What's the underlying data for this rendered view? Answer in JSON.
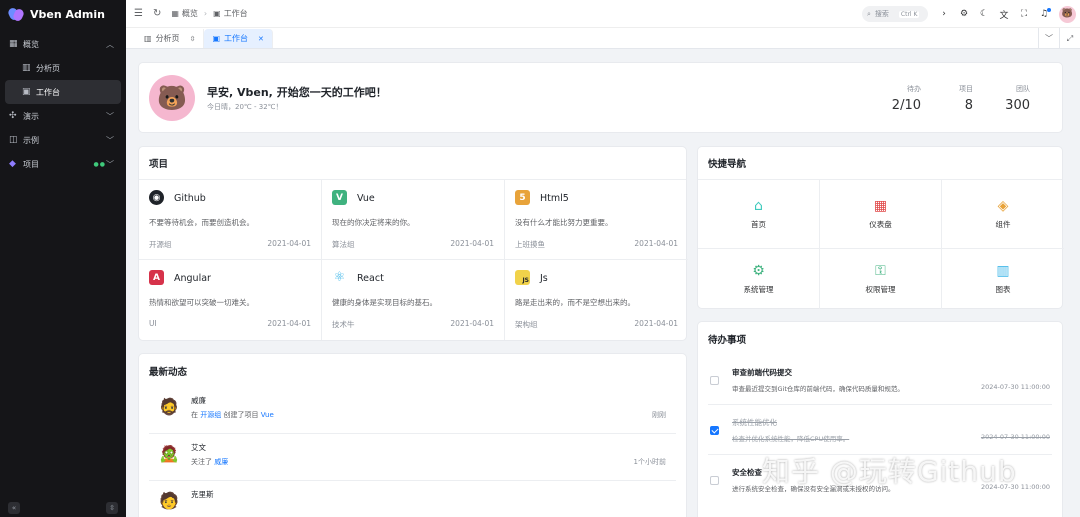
{
  "app": {
    "title": "Vben Admin"
  },
  "sidebar": {
    "items": [
      {
        "label": "概览",
        "icon": "grid-icon",
        "expanded": true
      },
      {
        "label": "分析页",
        "icon": "chart-icon"
      },
      {
        "label": "工作台",
        "icon": "workspace-icon",
        "active": true
      },
      {
        "label": "演示",
        "icon": "sparkle-icon"
      },
      {
        "label": "示例",
        "icon": "layers-icon"
      },
      {
        "label": "项目",
        "icon": "vben-logo-icon"
      }
    ],
    "collapse_label": "«",
    "pin_label": "⇳"
  },
  "header": {
    "breadcrumb": [
      "概览",
      "工作台"
    ],
    "search_placeholder": "搜索",
    "search_shortcut": "Ctrl K"
  },
  "tabs": [
    {
      "label": "分析页",
      "pinned": true
    },
    {
      "label": "工作台",
      "active": true
    }
  ],
  "welcome": {
    "greeting": "早安, Vben, 开始您一天的工作吧！",
    "weather": "今日晴，20℃ - 32℃！",
    "stats": [
      {
        "label": "待办",
        "value": "2/10"
      },
      {
        "label": "项目",
        "value": "8"
      },
      {
        "label": "团队",
        "value": "300"
      }
    ]
  },
  "projects": {
    "title": "项目",
    "items": [
      {
        "name": "Github",
        "desc": "不要等待机会，而要创造机会。",
        "group": "开源组",
        "date": "2021-04-01",
        "color": "#1f2329",
        "glyph": "◉"
      },
      {
        "name": "Vue",
        "desc": "现在的你决定将来的你。",
        "group": "算法组",
        "date": "2021-04-01",
        "color": "#3fb27f",
        "glyph": "V"
      },
      {
        "name": "Html5",
        "desc": "没有什么才能比努力更重要。",
        "group": "上班摸鱼",
        "date": "2021-04-01",
        "color": "#e8a33a",
        "glyph": "5"
      },
      {
        "name": "Angular",
        "desc": "热情和欲望可以突破一切难关。",
        "group": "UI",
        "date": "2021-04-01",
        "color": "#d6324a",
        "glyph": "A"
      },
      {
        "name": "React",
        "desc": "健康的身体是实现目标的基石。",
        "group": "技术牛",
        "date": "2021-04-01",
        "color": "#3db6e8",
        "glyph": "⚛"
      },
      {
        "name": "Js",
        "desc": "路是走出来的，而不是空想出来的。",
        "group": "架构组",
        "date": "2021-04-01",
        "color": "#f1d24a",
        "glyph": "JS"
      }
    ]
  },
  "news": {
    "title": "最新动态",
    "items": [
      {
        "name": "威廉",
        "text_pre": "在 ",
        "link1": "开源组",
        "text_mid": " 创建了项目 ",
        "link2": "Vue",
        "time": "刚刚"
      },
      {
        "name": "艾文",
        "text_pre": "关注了 ",
        "link1": "威廉",
        "text_mid": "",
        "link2": "",
        "time": "1个小时前"
      },
      {
        "name": "克里斯",
        "text_pre": "",
        "link1": "",
        "text_mid": "",
        "link2": "",
        "time": ""
      }
    ]
  },
  "quicknav": {
    "title": "快捷导航",
    "items": [
      {
        "label": "首页",
        "icon": "home-icon",
        "color": "#3fcabd",
        "glyph": "⌂"
      },
      {
        "label": "仪表盘",
        "icon": "dashboard-icon",
        "color": "#e04848",
        "glyph": "▦"
      },
      {
        "label": "组件",
        "icon": "component-icon",
        "color": "#e8a33a",
        "glyph": "◈"
      },
      {
        "label": "系统管理",
        "icon": "settings-icon",
        "color": "#3fb27f",
        "glyph": "⚙"
      },
      {
        "label": "权限管理",
        "icon": "key-icon",
        "color": "#3fb27f",
        "glyph": "⚿"
      },
      {
        "label": "图表",
        "icon": "chart-icon",
        "color": "#3db6e8",
        "glyph": "▥"
      }
    ]
  },
  "todo": {
    "title": "待办事项",
    "items": [
      {
        "title": "审查前端代码提交",
        "desc": "审查最近提交到Git仓库的前端代码，确保代码质量和规范。",
        "date": "2024-07-30 11:00:00",
        "done": false
      },
      {
        "title": "系统性能优化",
        "desc": "检查并优化系统性能，降低CPU使用率。",
        "date": "2024-07-30 11:00:00",
        "done": true
      },
      {
        "title": "安全检查",
        "desc": "进行系统安全检查，确保没有安全漏洞或未授权的访问。",
        "date": "2024-07-30 11:00:00",
        "done": false
      }
    ]
  },
  "watermark": "知乎 @玩转Github"
}
